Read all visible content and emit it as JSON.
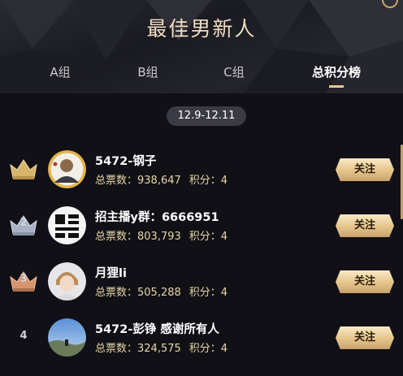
{
  "page": {
    "title": "最佳男新人"
  },
  "tabs": [
    {
      "label": "A组",
      "active": false
    },
    {
      "label": "B组",
      "active": false
    },
    {
      "label": "C组",
      "active": false
    },
    {
      "label": "总积分榜",
      "active": true
    }
  ],
  "date_range": "12.9-12.11",
  "colors": {
    "gold_accent": "#e7c98f",
    "stat_text": "#e8d6a4",
    "background": "#101016",
    "gold_crown": "#d8b36a",
    "silver_crown": "#a9b2c4",
    "bronze_crown": "#d6946e"
  },
  "ranking": [
    {
      "rank_label": "",
      "rank_badge": "gold-crown-icon",
      "name": "5472-钢子",
      "votes_text": "总票数：938,647",
      "score_text": "积分：4",
      "follow_label": "关注",
      "avatar": "portrait-with-gold-ring"
    },
    {
      "rank_label": "2",
      "rank_badge": "silver-crown-icon",
      "name": "招主播y群：6666951",
      "votes_text": "总票数：803,793",
      "score_text": "积分：4",
      "follow_label": "关注",
      "avatar": "black-white-logo"
    },
    {
      "rank_label": "3",
      "rank_badge": "bronze-crown-icon",
      "name": "月狸li",
      "votes_text": "总票数：505,288",
      "score_text": "积分：4",
      "follow_label": "关注",
      "avatar": "portrait-light"
    },
    {
      "rank_label": "4",
      "rank_badge": "",
      "name": "5472-彭铮 感谢所有人",
      "votes_text": "总票数：324,575",
      "score_text": "积分：4",
      "follow_label": "关注",
      "avatar": "landscape-sky"
    }
  ]
}
